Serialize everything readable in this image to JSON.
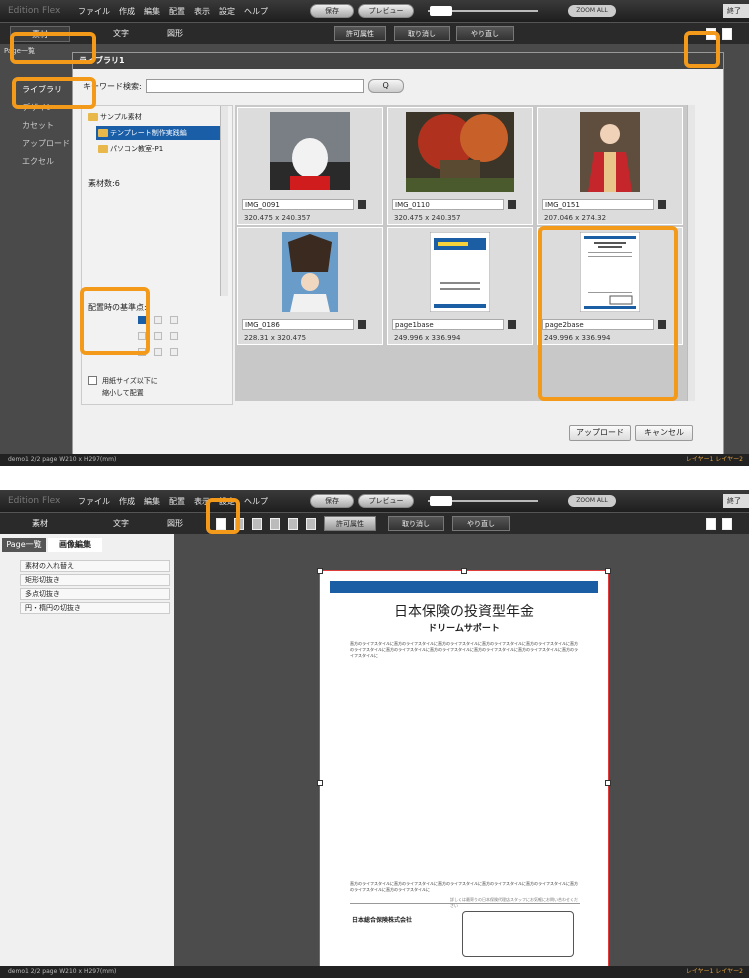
{
  "app": {
    "logo": "Edition Flex",
    "menu": [
      "ファイル",
      "作成",
      "編集",
      "配置",
      "表示",
      "設定",
      "ヘルプ"
    ],
    "save_label": "保存",
    "preview_label": "プレビュー",
    "zoom_all_label": "ZOOM ALL",
    "exit_label": "終了"
  },
  "toolbar": {
    "tabs": [
      "素材",
      "文字",
      "図形"
    ],
    "permission_label": "許可属性",
    "undo_label": "取り消し",
    "redo_label": "やり直し"
  },
  "screen1": {
    "sidebar": {
      "header": "Page一覧",
      "items": [
        "ライブラリ",
        "デザイン",
        "カセット",
        "アップロード",
        "エクセル"
      ]
    },
    "dialog": {
      "title": "ライブラリ1",
      "search_label": "キーワード検索:",
      "search_value": "",
      "search_button": "Q",
      "tree": [
        "サンプル素材",
        "テンプレート制作実践編",
        "パソコン教室-P1"
      ],
      "count_label": "素材数:6",
      "anchor_label": "配置時の基準点:",
      "shrink_label_1": "用紙サイズ以下に",
      "shrink_label_2": "縮小して配置",
      "upload_button": "アップロード",
      "cancel_button": "キャンセル",
      "items": [
        {
          "name": "IMG_0091",
          "size": "320.475 x 240.357"
        },
        {
          "name": "IMG_0110",
          "size": "320.475 x 240.357"
        },
        {
          "name": "IMG_0151",
          "size": "207.046 x 274.32"
        },
        {
          "name": "IMG_0186",
          "size": "228.31 x 320.475"
        },
        {
          "name": "page1base",
          "size": "249.996 x 336.994"
        },
        {
          "name": "page2base",
          "size": "249.996 x 336.994"
        }
      ]
    },
    "status": "demo1 2/2 page W210 x H297(mm)",
    "layers": "レイヤー1   レイヤー2"
  },
  "screen2": {
    "panel_tabs": [
      "Page一覧",
      "画像編集"
    ],
    "panel_items": [
      "素材の入れ替え",
      "矩形切抜き",
      "多点切抜き",
      "円・楕円の切抜き"
    ],
    "page": {
      "title": "日本保険の投資型年金",
      "subtitle": "ドリームサポート",
      "body1": "直方のライフスタイルに直方のライフスタイルに直方のライフスタイルに直方のライフスタイルに直方のライフスタイルに直方のライフスタイルに直方のライフスタイルに直方のライフスタイルに直方のライフスタイルに直方のライフスタイルに直方のライフスタイルに",
      "body2": "直方のライフスタイルに直方のライフスタイルに直方のライフスタイルに直方のライフスタイルに直方のライフスタイルに直方のライフスタイルに直方のライフスタイルに",
      "note": "詳しくは最寄りの日本保険代理店スタッフにお気軽にお問い合わせください",
      "company": "日本総合保険株式会社"
    },
    "status": "demo1 2/2 page W210 x H297(mm)",
    "layers": "レイヤー1   レイヤー2"
  }
}
